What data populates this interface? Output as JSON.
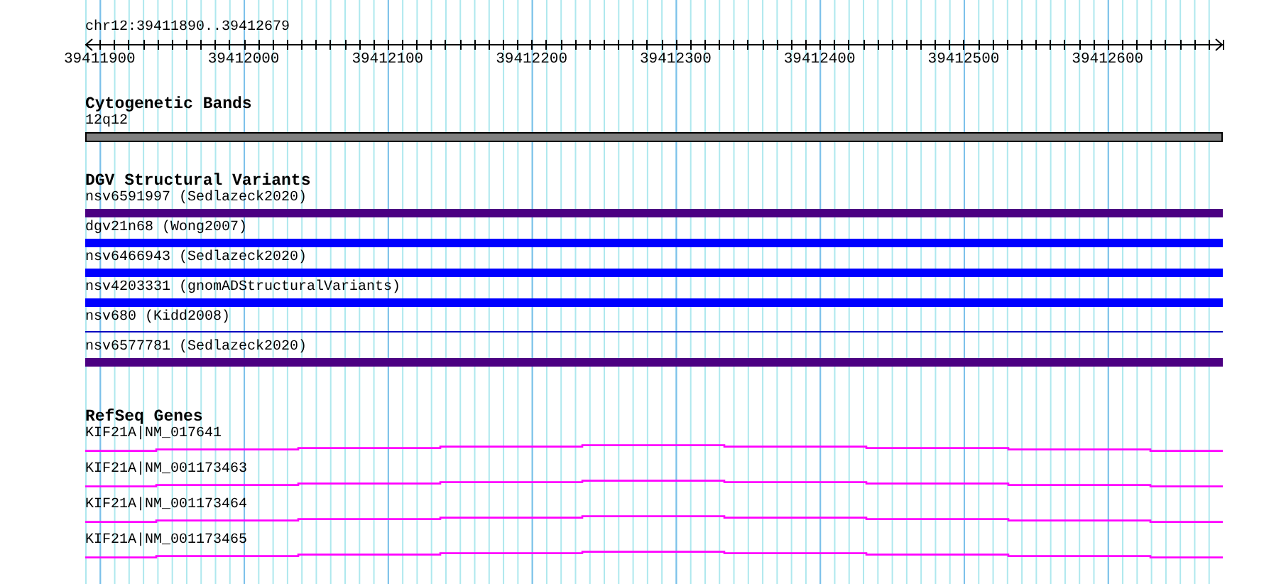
{
  "ruler": {
    "location": "chr12:39411890..39412679",
    "tick_labels": [
      "39411900",
      "39412000",
      "39412100",
      "39412200",
      "39412300",
      "39412400",
      "39412500",
      "39412600"
    ]
  },
  "tracks": [
    {
      "kind": "band",
      "title": "Cytogenetic Bands",
      "features": [
        {
          "label": "12q12",
          "color": "#808080"
        }
      ]
    },
    {
      "kind": "variant",
      "title": "DGV Structural Variants",
      "features": [
        {
          "label": "nsv6591997 (Sedlazeck2020)",
          "kind": "bar",
          "color": "#4b0082"
        },
        {
          "label": "dgv21n68 (Wong2007)",
          "kind": "bar",
          "color": "#0000ff"
        },
        {
          "label": "nsv6466943 (Sedlazeck2020)",
          "kind": "bar",
          "color": "#0000ff"
        },
        {
          "label": "nsv4203331 (gnomADStructuralVariants)",
          "kind": "bar",
          "color": "#0000ff"
        },
        {
          "label": "nsv680 (Kidd2008)",
          "kind": "line",
          "color": "#0000c0"
        },
        {
          "label": "nsv6577781 (Sedlazeck2020)",
          "kind": "bar",
          "color": "#4b0082"
        }
      ]
    },
    {
      "kind": "gene",
      "title": "RefSeq Genes",
      "features": [
        {
          "label": "KIF21A|NM_017641",
          "color": "#ff00ff"
        },
        {
          "label": "KIF21A|NM_001173463",
          "color": "#ff00ff"
        },
        {
          "label": "KIF21A|NM_001173464",
          "color": "#ff00ff"
        },
        {
          "label": "KIF21A|NM_001173465",
          "color": "#ff00ff"
        }
      ]
    }
  ]
}
